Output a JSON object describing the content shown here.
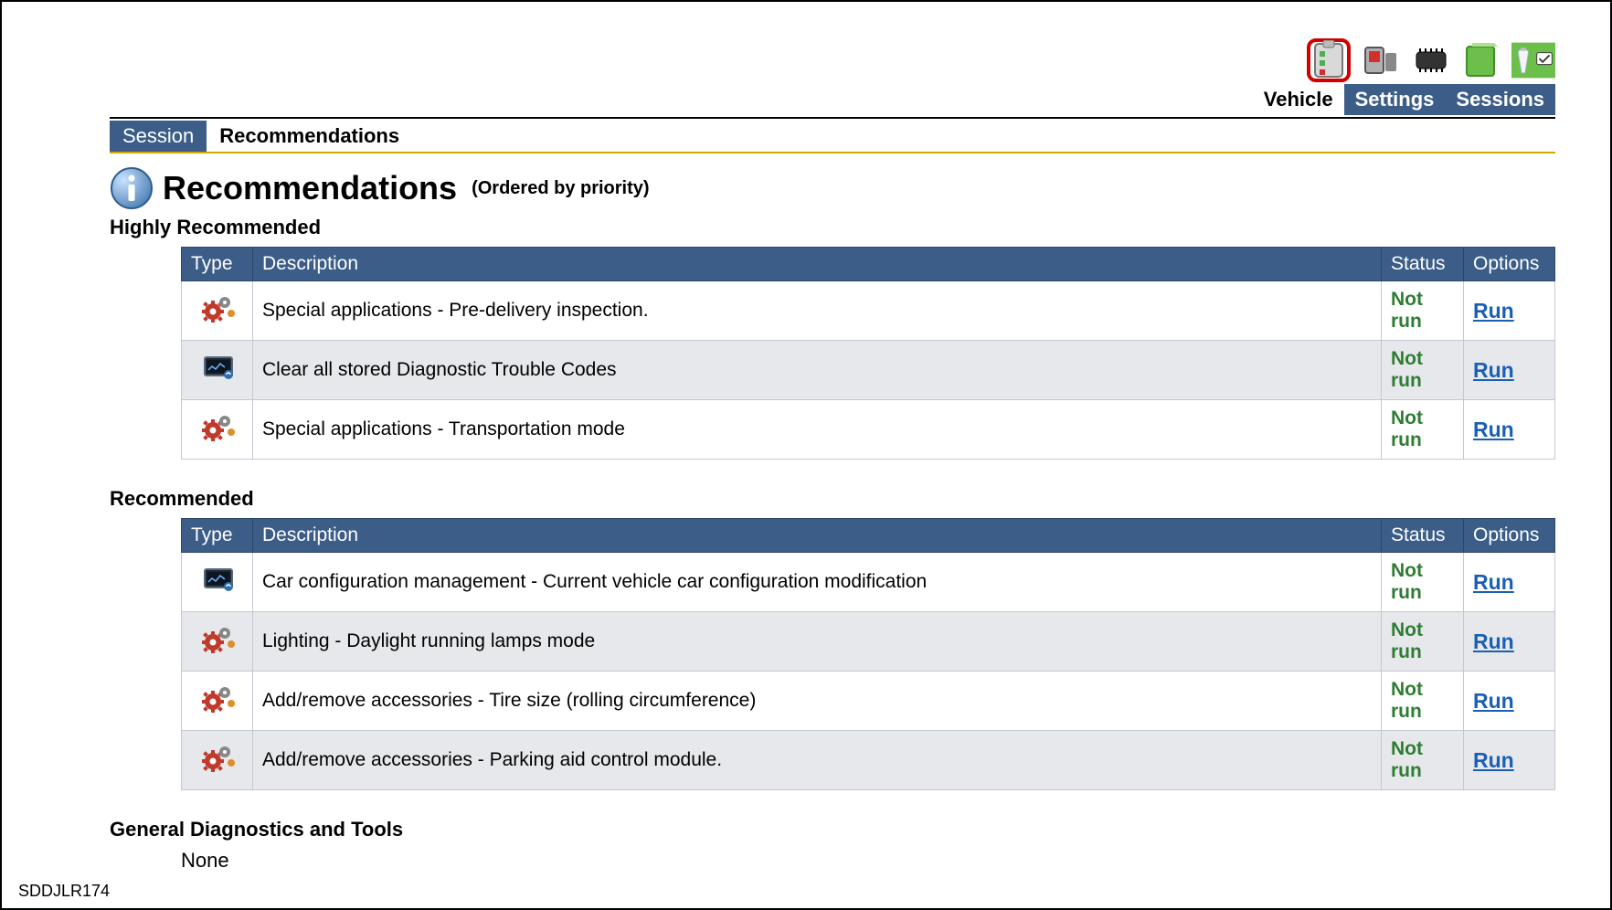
{
  "top_nav": {
    "tabs": [
      {
        "label": "Vehicle",
        "active": true
      },
      {
        "label": "Settings",
        "active": false
      },
      {
        "label": "Sessions",
        "active": false
      }
    ]
  },
  "sub_tabs": {
    "session": "Session",
    "recommendations": "Recommendations"
  },
  "header": {
    "title": "Recommendations",
    "subtitle": "(Ordered by priority)"
  },
  "sections": {
    "highly_recommended": {
      "label": "Highly Recommended",
      "columns": {
        "type": "Type",
        "description": "Description",
        "status": "Status",
        "options": "Options"
      },
      "rows": [
        {
          "icon": "gear",
          "description": "Special applications - Pre-delivery inspection.",
          "status": "Not run",
          "option": "Run"
        },
        {
          "icon": "screen",
          "description": "Clear all stored Diagnostic Trouble Codes",
          "status": "Not run",
          "option": "Run"
        },
        {
          "icon": "gear",
          "description": "Special applications - Transportation mode",
          "status": "Not run",
          "option": "Run"
        }
      ]
    },
    "recommended": {
      "label": "Recommended",
      "columns": {
        "type": "Type",
        "description": "Description",
        "status": "Status",
        "options": "Options"
      },
      "rows": [
        {
          "icon": "screen",
          "description": "Car configuration management - Current vehicle car configuration modification",
          "status": "Not run",
          "option": "Run"
        },
        {
          "icon": "gear",
          "description": "Lighting - Daylight running lamps mode",
          "status": "Not run",
          "option": "Run"
        },
        {
          "icon": "gear",
          "description": "Add/remove accessories - Tire size (rolling circumference)",
          "status": "Not run",
          "option": "Run"
        },
        {
          "icon": "gear",
          "description": "Add/remove accessories - Parking aid control module.",
          "status": "Not run",
          "option": "Run"
        }
      ]
    },
    "general_diag": {
      "label": "General Diagnostics and Tools",
      "none": "None"
    }
  },
  "footer_code": "SDDJLR174"
}
